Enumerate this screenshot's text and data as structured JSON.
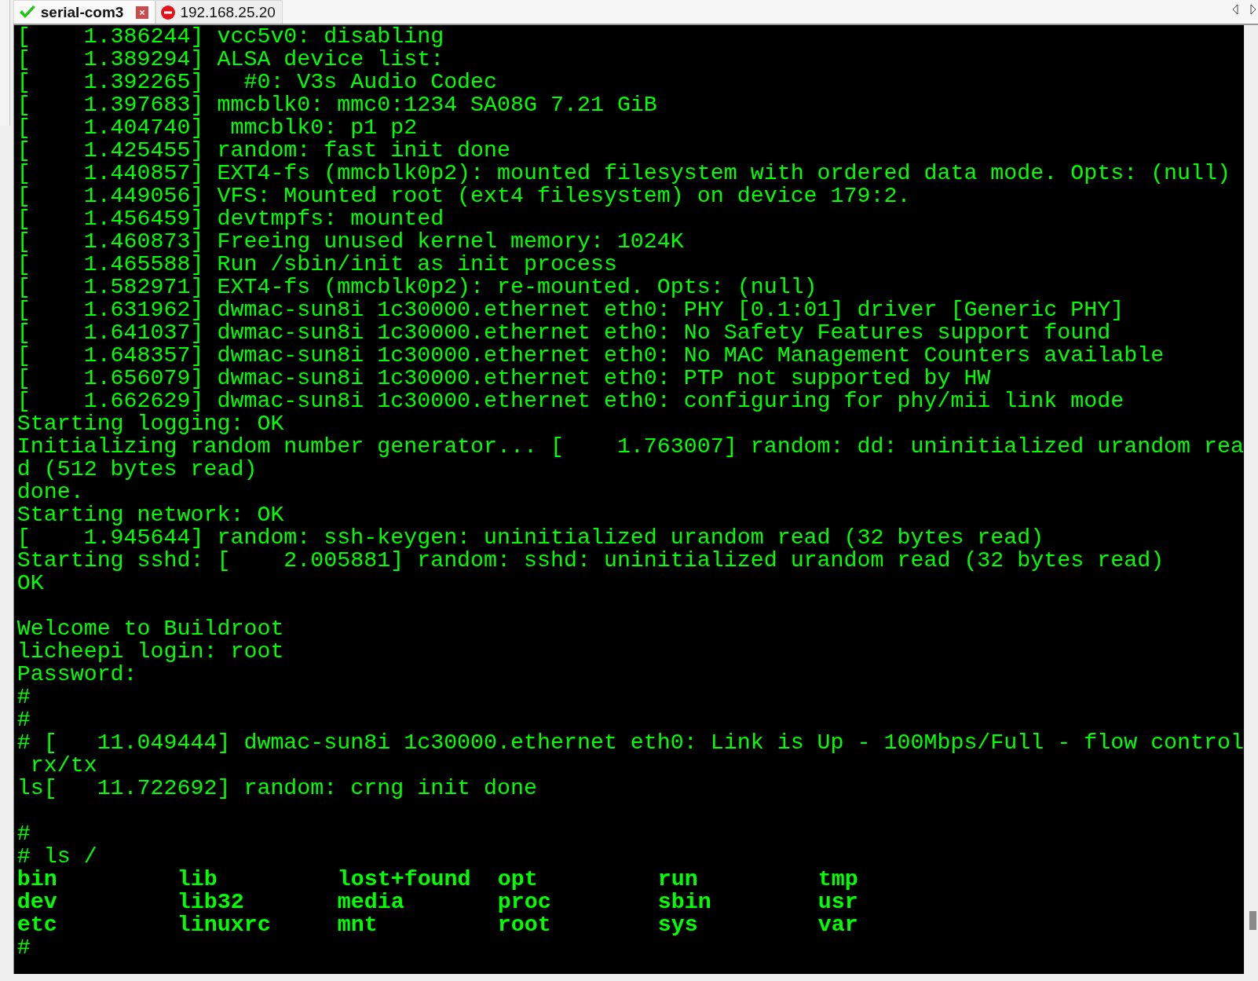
{
  "tabs": [
    {
      "label": "serial-com3",
      "kind": "connected",
      "selected": true
    },
    {
      "label": "192.168.25.20",
      "kind": "disconnected",
      "selected": false
    }
  ],
  "terminal": {
    "lines": [
      {
        "kind": "text",
        "text": "[    1.386244] vcc5v0: disabling"
      },
      {
        "kind": "text",
        "text": "[    1.389294] ALSA device list:"
      },
      {
        "kind": "text",
        "text": "[    1.392265]   #0: V3s Audio Codec"
      },
      {
        "kind": "text",
        "text": "[    1.397683] mmcblk0: mmc0:1234 SA08G 7.21 GiB"
      },
      {
        "kind": "text",
        "text": "[    1.404740]  mmcblk0: p1 p2"
      },
      {
        "kind": "text",
        "text": "[    1.425455] random: fast init done"
      },
      {
        "kind": "text",
        "text": "[    1.440857] EXT4-fs (mmcblk0p2): mounted filesystem with ordered data mode. Opts: (null)"
      },
      {
        "kind": "text",
        "text": "[    1.449056] VFS: Mounted root (ext4 filesystem) on device 179:2."
      },
      {
        "kind": "text",
        "text": "[    1.456459] devtmpfs: mounted"
      },
      {
        "kind": "text",
        "text": "[    1.460873] Freeing unused kernel memory: 1024K"
      },
      {
        "kind": "text",
        "text": "[    1.465588] Run /sbin/init as init process"
      },
      {
        "kind": "text",
        "text": "[    1.582971] EXT4-fs (mmcblk0p2): re-mounted. Opts: (null)"
      },
      {
        "kind": "text",
        "text": "[    1.631962] dwmac-sun8i 1c30000.ethernet eth0: PHY [0.1:01] driver [Generic PHY]"
      },
      {
        "kind": "text",
        "text": "[    1.641037] dwmac-sun8i 1c30000.ethernet eth0: No Safety Features support found"
      },
      {
        "kind": "text",
        "text": "[    1.648357] dwmac-sun8i 1c30000.ethernet eth0: No MAC Management Counters available"
      },
      {
        "kind": "text",
        "text": "[    1.656079] dwmac-sun8i 1c30000.ethernet eth0: PTP not supported by HW"
      },
      {
        "kind": "text",
        "text": "[    1.662629] dwmac-sun8i 1c30000.ethernet eth0: configuring for phy/mii link mode"
      },
      {
        "kind": "text",
        "text": "Starting logging: OK"
      },
      {
        "kind": "text",
        "text": "Initializing random number generator... [    1.763007] random: dd: uninitialized urandom rea"
      },
      {
        "kind": "text",
        "text": "d (512 bytes read)"
      },
      {
        "kind": "text",
        "text": "done."
      },
      {
        "kind": "text",
        "text": "Starting network: OK"
      },
      {
        "kind": "text",
        "text": "[    1.945644] random: ssh-keygen: uninitialized urandom read (32 bytes read)"
      },
      {
        "kind": "text",
        "text": "Starting sshd: [    2.005881] random: sshd: uninitialized urandom read (32 bytes read)"
      },
      {
        "kind": "text",
        "text": "OK"
      },
      {
        "kind": "blank"
      },
      {
        "kind": "text",
        "text": "Welcome to Buildroot"
      },
      {
        "kind": "text",
        "text": "licheepi login: root"
      },
      {
        "kind": "text",
        "text": "Password:"
      },
      {
        "kind": "text",
        "text": "#"
      },
      {
        "kind": "text",
        "text": "#"
      },
      {
        "kind": "text",
        "text": "# [   11.049444] dwmac-sun8i 1c30000.ethernet eth0: Link is Up - 100Mbps/Full - flow control"
      },
      {
        "kind": "text",
        "text": " rx/tx"
      },
      {
        "kind": "text",
        "text": "ls[   11.722692] random: crng init done"
      },
      {
        "kind": "blank"
      },
      {
        "kind": "text",
        "text": "#"
      },
      {
        "kind": "text",
        "text": "# ls /"
      },
      {
        "kind": "columns",
        "cells": [
          "bin",
          "lib",
          "lost+found",
          "opt",
          "run",
          "tmp"
        ]
      },
      {
        "kind": "columns",
        "cells": [
          "dev",
          "lib32",
          "media",
          "proc",
          "sbin",
          "usr"
        ]
      },
      {
        "kind": "columns",
        "cells": [
          "etc",
          "linuxrc",
          "mnt",
          "root",
          "sys",
          "var"
        ]
      },
      {
        "kind": "text",
        "text": "#"
      }
    ]
  }
}
